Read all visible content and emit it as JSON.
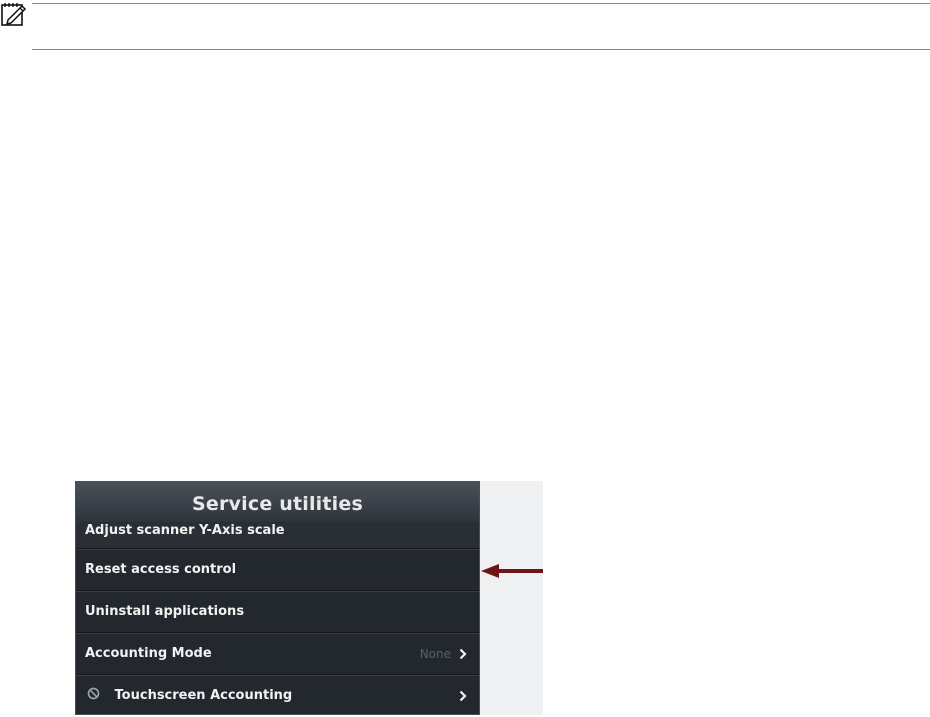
{
  "note": {
    "icon": "note-pencil-icon",
    "rule_color": "#3aa0c8"
  },
  "panel": {
    "title": "Service utilities",
    "rows": [
      {
        "label": "Adjust scanner Y-Axis scale"
      },
      {
        "label": "Reset access control"
      },
      {
        "label": "Uninstall applications"
      },
      {
        "label": "Accounting Mode",
        "value": "None"
      },
      {
        "label": "Touchscreen Accounting"
      }
    ]
  },
  "colors": {
    "panel_bg": "#23272e",
    "arrow": "#6e1518"
  }
}
